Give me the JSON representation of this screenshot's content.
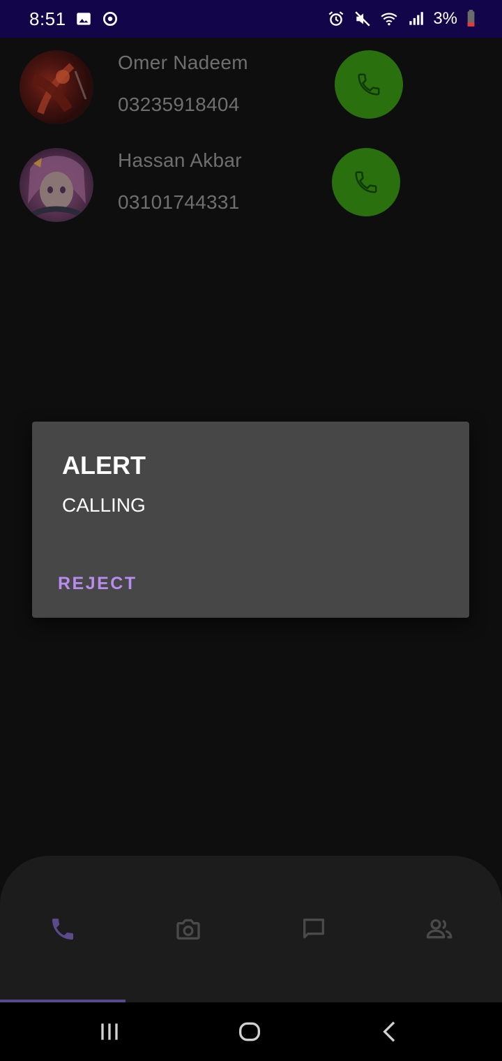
{
  "status_bar": {
    "time": "8:51",
    "battery_percent": "3%",
    "left_icons": [
      "gallery-icon",
      "sync-icon"
    ],
    "right_icons": [
      "alarm-icon",
      "mute-icon",
      "wifi-icon",
      "signal-icon",
      "battery-icon"
    ]
  },
  "contacts": [
    {
      "name": "Omer Nadeem",
      "number": "03235918404"
    },
    {
      "name": "Hassan Akbar",
      "number": "03101744331"
    }
  ],
  "dialog": {
    "title": "ALERT",
    "message": "CALLING",
    "button_label": "REJECT"
  },
  "bottom_nav": {
    "items": [
      {
        "icon": "phone-icon",
        "selected": true
      },
      {
        "icon": "camera-icon",
        "selected": false
      },
      {
        "icon": "chat-icon",
        "selected": false
      },
      {
        "icon": "contacts-icon",
        "selected": false
      }
    ]
  },
  "system_nav": [
    "recents-icon",
    "home-icon",
    "back-icon"
  ],
  "colors": {
    "status_bar": "#13054a",
    "call_button": "#2a700f",
    "dialog_bg": "#474747",
    "dialog_button": "#b98cf0",
    "selected_nav": "#5a4a8c"
  }
}
